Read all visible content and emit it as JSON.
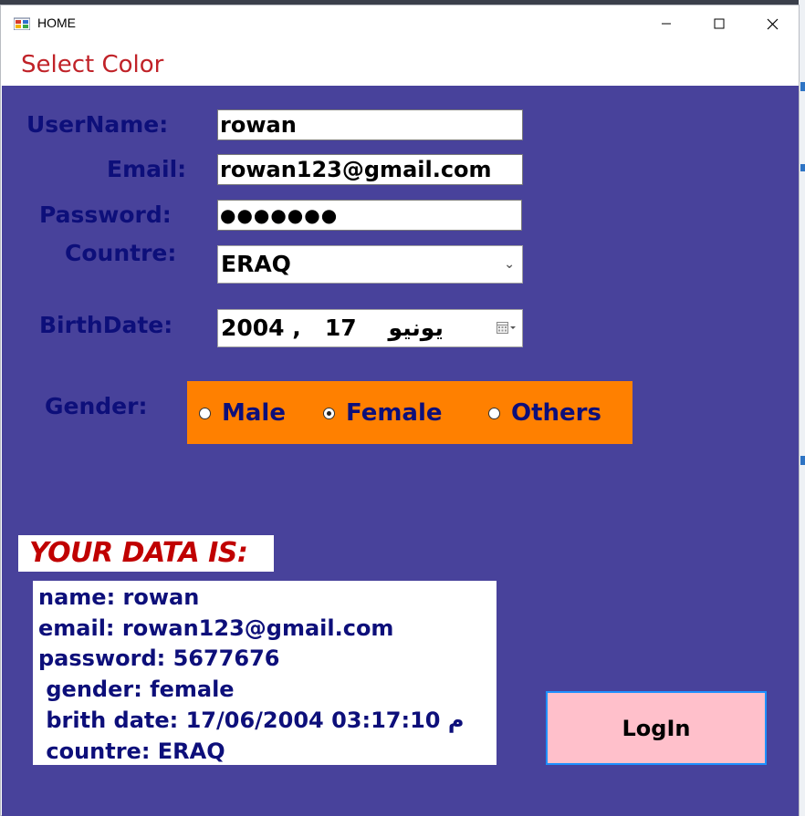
{
  "window": {
    "title": "HOME"
  },
  "menu": {
    "select_color": "Select Color"
  },
  "form": {
    "username_label": "UserName:",
    "username_value": "rowan",
    "email_label": "Email:",
    "email_value": "rowan123@gmail.com",
    "password_label": "Password:",
    "password_value": "●●●●●●●",
    "country_label": "Countre:",
    "country_value": "ERAQ",
    "birthdate_label": "BirthDate:",
    "birthdate_value": "2004 ,   يونيو    17",
    "gender_label": "Gender:",
    "gender_options": [
      "Male",
      "Female",
      "Others"
    ],
    "gender_selected": "Female"
  },
  "output": {
    "heading": "YOUR DATA IS:",
    "lines": [
      "name: rowan",
      "email: rowan123@gmail.com",
      "password: 5677676",
      " gender: female",
      " brith date: 17/06/2004 03:17:10 م",
      " countre: ERAQ"
    ]
  },
  "buttons": {
    "login": "LogIn"
  },
  "colors": {
    "client_bg": "#48429b",
    "label_text": "#0d0f7a",
    "gender_panel": "#ff8000",
    "heading_text": "#c00000",
    "menu_text": "#c02228",
    "login_bg": "#ffc0cb",
    "login_border": "#1e90ff"
  },
  "icons": {
    "app": "app-icon",
    "minimize": "minimize-icon",
    "maximize": "maximize-icon",
    "close": "close-icon",
    "dropdown": "chevron-down-icon",
    "calendar": "calendar-icon"
  }
}
